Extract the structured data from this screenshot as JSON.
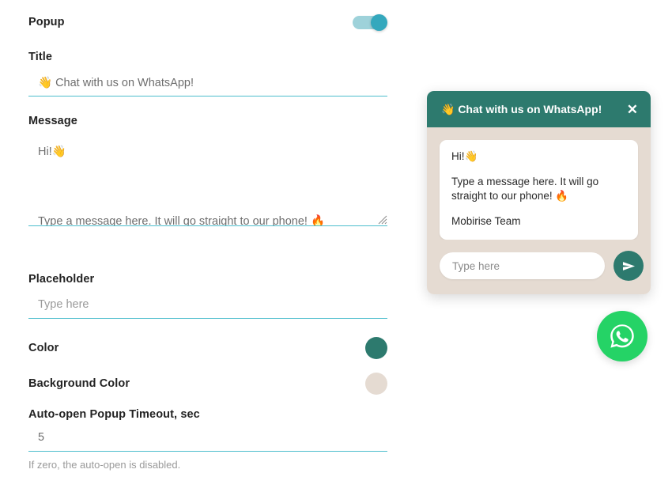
{
  "settings": {
    "popup": {
      "label": "Popup",
      "enabled": true
    },
    "title": {
      "label": "Title",
      "value": "👋 Chat with us on WhatsApp!",
      "placeholder": ""
    },
    "message": {
      "label": "Message",
      "value": "Hi!👋\n\nType a message here. It will go straight to our phone! 🔥\n\nMobirise Team",
      "placeholder": ""
    },
    "placeholder_field": {
      "label": "Placeholder",
      "value": "Type here",
      "placeholder": "Type here"
    },
    "color": {
      "label": "Color",
      "value": "#2d7a6e"
    },
    "background_color": {
      "label": "Background Color",
      "value": "#e5dbd2"
    },
    "timeout": {
      "label": "Auto-open Popup Timeout, sec",
      "value": "5",
      "hint": "If zero, the auto-open is disabled."
    }
  },
  "preview": {
    "header": {
      "title": "👋 Chat with us on WhatsApp!",
      "close_label": "✕"
    },
    "bubble": {
      "lines": [
        "Hi!👋",
        "Type a message here. It will go straight to our phone! 🔥",
        "Mobirise Team"
      ]
    },
    "input": {
      "value": "",
      "placeholder": "Type here"
    },
    "send_button_label": "send-icon",
    "fab_label": "whatsapp-icon"
  },
  "theme": {
    "accent_teal": "#2d7a6e",
    "toggle_on": "#34a8bd",
    "toggle_track": "#9ed2da",
    "underline": "#4dbecd",
    "whatsapp_green": "#25d366",
    "widget_bg": "#e5dbd2",
    "label_color": "#232323",
    "value_color": "#6e6e6e"
  }
}
